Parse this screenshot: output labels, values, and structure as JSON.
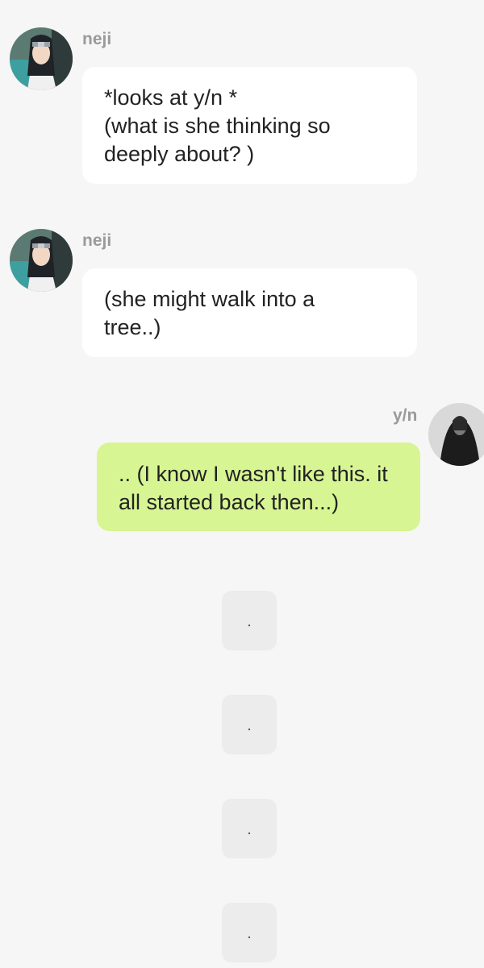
{
  "messages": [
    {
      "sender": "neji",
      "text": "*looks at y/n *\n(what is she thinking so deeply about?  )",
      "side": "left"
    },
    {
      "sender": "neji",
      "text": "(she might walk into a tree..)",
      "side": "left"
    },
    {
      "sender": "y/n",
      "text": ".. (I know I wasn't like this. it all started back then...)",
      "side": "right"
    }
  ],
  "dots": [
    ".",
    ".",
    ".",
    "."
  ],
  "colors": {
    "background": "#f6f6f6",
    "bubble_in": "#ffffff",
    "bubble_out": "#d7f593",
    "name": "#9a9a9a"
  }
}
